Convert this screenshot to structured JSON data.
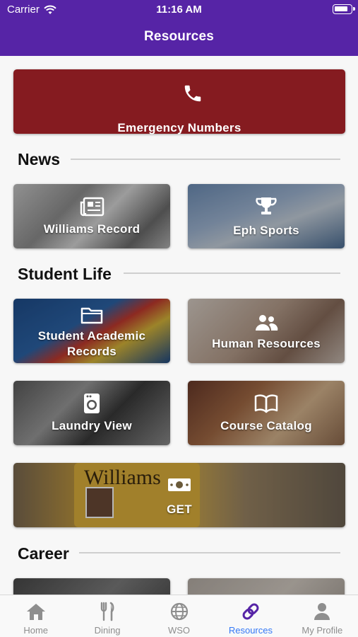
{
  "status_bar": {
    "carrier": "Carrier",
    "time": "11:16 AM"
  },
  "nav": {
    "title": "Resources"
  },
  "emergency": {
    "label": "Emergency Numbers",
    "icon": "phone-icon"
  },
  "sections": {
    "news": "News",
    "student_life": "Student Life",
    "career": "Career"
  },
  "tiles": {
    "williams_record": "Williams Record",
    "eph_sports": "Eph Sports",
    "student_academic_records": "Student Academic Records",
    "human_resources": "Human Resources",
    "laundry_view": "Laundry View",
    "course_catalog": "Course Catalog",
    "get": "GET"
  },
  "get_card": {
    "brand": "Williams"
  },
  "tabbar": {
    "items": [
      {
        "label": "Home",
        "icon": "home-icon"
      },
      {
        "label": "Dining",
        "icon": "utensils-icon"
      },
      {
        "label": "WSO",
        "icon": "globe-icon"
      },
      {
        "label": "Resources",
        "icon": "link-icon",
        "active": true
      },
      {
        "label": "My Profile",
        "icon": "user-icon"
      }
    ]
  },
  "colors": {
    "header": "#5624a6",
    "emergency": "#851b20",
    "active_tab_label": "#3478f6"
  }
}
